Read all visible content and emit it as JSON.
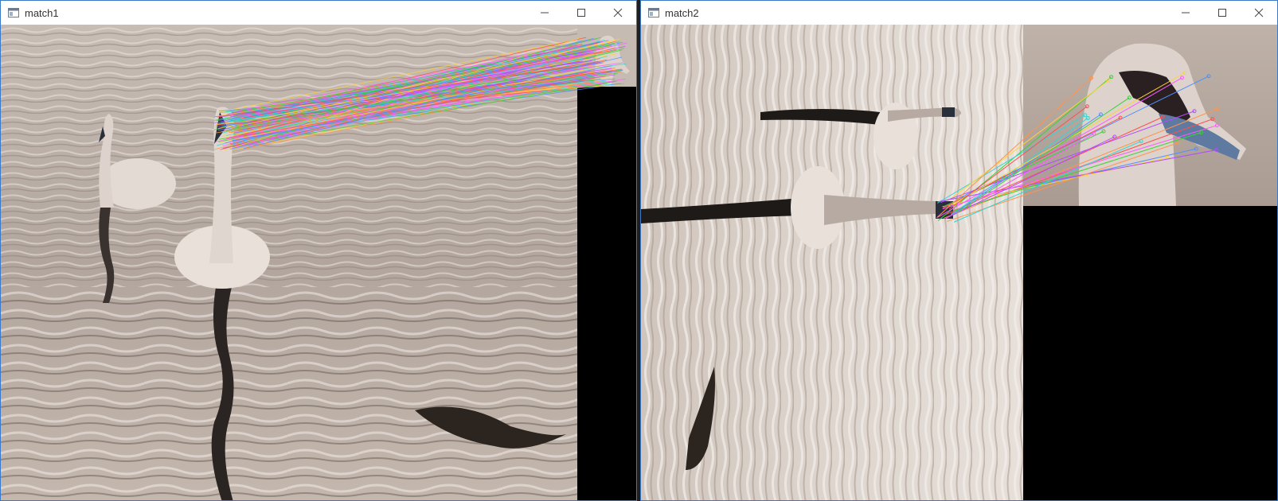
{
  "windows": [
    {
      "title": "match1",
      "controls": {
        "minimize_icon": "minimize-icon",
        "maximize_icon": "maximize-icon",
        "close_icon": "close-icon"
      }
    },
    {
      "title": "match2",
      "controls": {
        "minimize_icon": "minimize-icon",
        "maximize_icon": "maximize-icon",
        "close_icon": "close-icon"
      }
    }
  ],
  "colors": {
    "water": "#b9aea6",
    "swan_body": "#e6ddd6",
    "beak": "#5e7aa0",
    "beak_knob": "#1e1e2a",
    "reflection": "#2a2522",
    "match_lines": [
      "#ff4f4f",
      "#3ad23a",
      "#4f8fff",
      "#ff59ff",
      "#ffd23a",
      "#31d6d6",
      "#b44bff",
      "#ff944d"
    ]
  }
}
